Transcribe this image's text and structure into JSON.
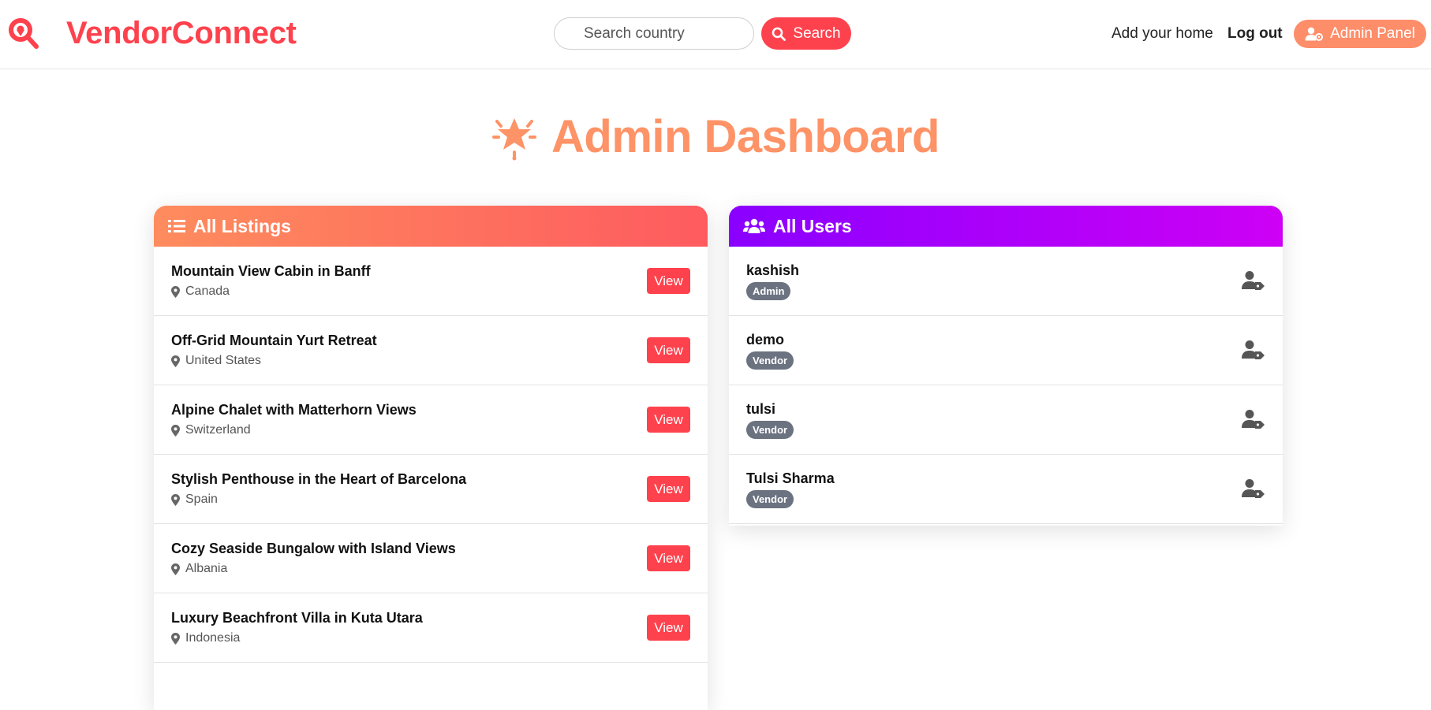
{
  "nav": {
    "brand": "VendorConnect",
    "search_placeholder": "Search country",
    "search_button": "Search",
    "add_home": "Add your home",
    "logout": "Log out",
    "admin_panel": "Admin Panel"
  },
  "page": {
    "title": "Admin Dashboard"
  },
  "listings": {
    "header": "All Listings",
    "view_label": "View",
    "items": [
      {
        "title": "Mountain View Cabin in Banff",
        "country": "Canada"
      },
      {
        "title": "Off-Grid Mountain Yurt Retreat",
        "country": "United States"
      },
      {
        "title": "Alpine Chalet with Matterhorn Views",
        "country": "Switzerland"
      },
      {
        "title": "Stylish Penthouse in the Heart of Barcelona",
        "country": "Spain"
      },
      {
        "title": "Cozy Seaside Bungalow with Island Views",
        "country": "Albania"
      },
      {
        "title": "Luxury Beachfront Villa in Kuta Utara",
        "country": "Indonesia"
      }
    ]
  },
  "users": {
    "header": "All Users",
    "items": [
      {
        "name": "kashish",
        "role": "Admin"
      },
      {
        "name": "demo",
        "role": "Vendor"
      },
      {
        "name": "tulsi",
        "role": "Vendor"
      },
      {
        "name": "Tulsi Sharma",
        "role": "Vendor"
      }
    ]
  },
  "colors": {
    "brand": "#fe424d",
    "admin_button": "#fe8d6a",
    "title": "#fd9366",
    "listings_gradient": [
      "#fe8c5e",
      "#fe5b5f"
    ],
    "users_gradient": [
      "#8a00ff",
      "#ce00f5"
    ],
    "badge": "#6b7280"
  },
  "icons": {
    "brand": "search-location-icon",
    "search": "magnifier-icon",
    "admin": "user-gear-icon",
    "title": "starburst-icon",
    "listings": "list-icon",
    "users": "users-group-icon",
    "location": "map-pin-icon",
    "user_row": "user-tag-icon"
  }
}
